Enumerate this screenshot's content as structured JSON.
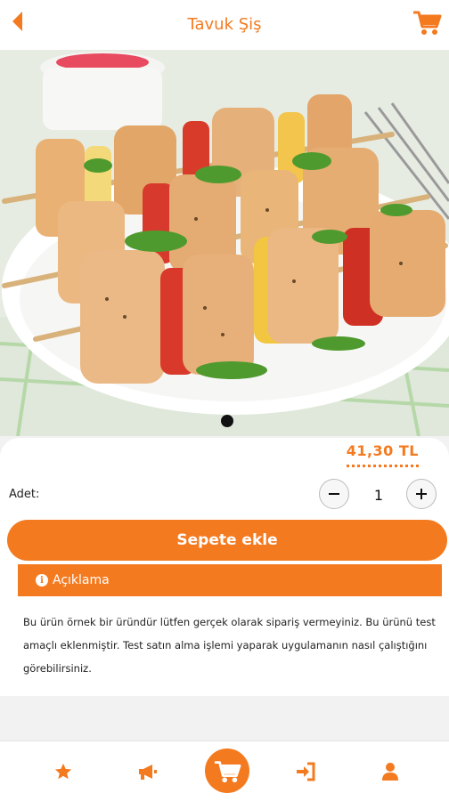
{
  "header": {
    "title": "Tavuk Şiş",
    "back_icon": "chevron-left-icon",
    "cart_icon": "shopping-cart-icon"
  },
  "product": {
    "image_description_icon": "product-photo",
    "price": "41,30 TL",
    "quantity_label": "Adet:",
    "quantity": "1",
    "add_to_cart_label": "Sepete ekle",
    "description_title": "Açıklama",
    "description_text": "Bu ürün örnek bir üründür lütfen gerçek olarak sipariş vermeyiniz. Bu ürünü test amaçlı eklenmiştir. Test satın alma işlemi yaparak uygulamanın nasıl çalıştığını görebilirsiniz."
  },
  "carousel": {
    "active_index": 1,
    "count": 1
  },
  "bottom_nav": [
    {
      "icon": "star-icon"
    },
    {
      "icon": "megaphone-icon"
    },
    {
      "icon": "cart-icon",
      "active": true
    },
    {
      "icon": "login-icon"
    },
    {
      "icon": "user-icon"
    }
  ],
  "colors": {
    "accent": "#f47a20",
    "background": "#f2f2f2"
  }
}
